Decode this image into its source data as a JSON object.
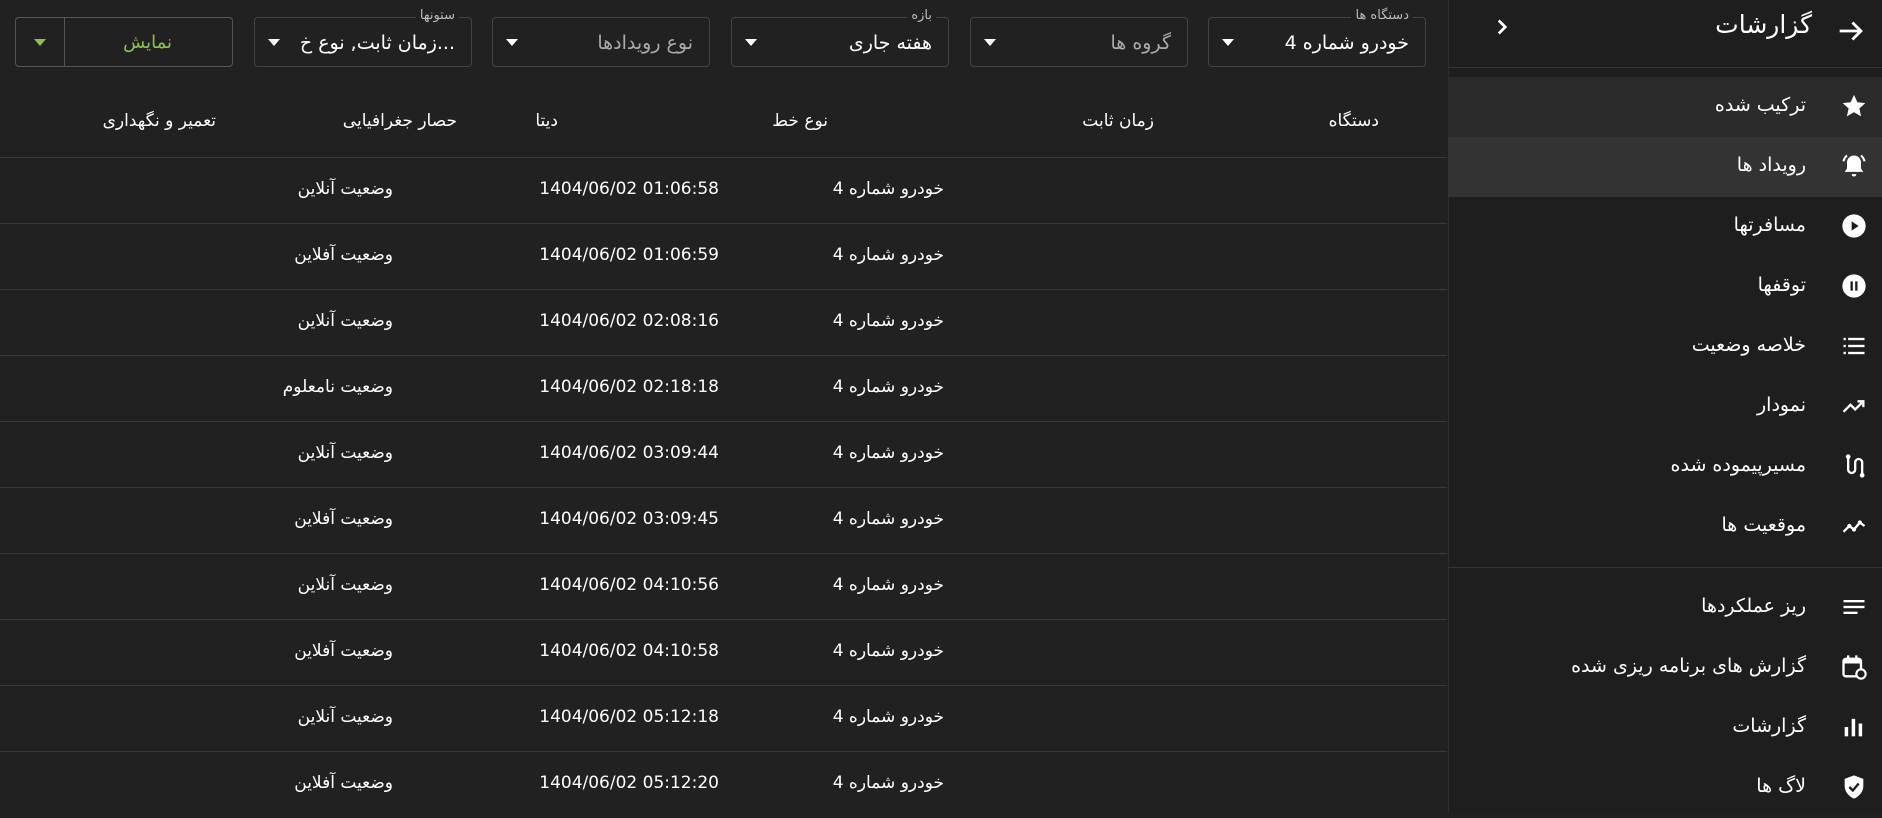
{
  "sidebar": {
    "title": "گزارشات",
    "items": [
      {
        "label": "ترکیب شده",
        "icon": "star-icon"
      },
      {
        "label": "رویداد ها",
        "icon": "bell-icon"
      },
      {
        "label": "مسافرتها",
        "icon": "play-circle-icon"
      },
      {
        "label": "توقفها",
        "icon": "pause-circle-icon"
      },
      {
        "label": "خلاصه وضعیت",
        "icon": "list-icon"
      },
      {
        "label": "نمودار",
        "icon": "trending-up-icon"
      },
      {
        "label": "مسیرپیموده شده",
        "icon": "route-icon"
      },
      {
        "label": "موقعیت ها",
        "icon": "timeline-icon"
      },
      {
        "label": "ریز عملکردها",
        "icon": "notes-icon"
      },
      {
        "label": "گزارش های برنامه ریزی شده",
        "icon": "calendar-clock-icon"
      },
      {
        "label": "گزارشات",
        "icon": "bar-chart-icon"
      },
      {
        "label": "لاگ ها",
        "icon": "shield-check-icon"
      }
    ]
  },
  "filters": {
    "devices": {
      "legend": "دستگاه ها",
      "value": "خودرو شماره 4"
    },
    "groups": {
      "placeholder": "گروه ها"
    },
    "period": {
      "legend": "بازه",
      "value": "هفته جاری"
    },
    "event_types": {
      "placeholder": "نوع رویدادها"
    },
    "columns": {
      "legend": "ستونها",
      "value": "زمان ثابت, نوع خ..."
    },
    "show_button": "نمایش"
  },
  "table": {
    "headers": {
      "device": "دستگاه",
      "fix_time": "زمان ثابت",
      "type": "نوع خط",
      "data": "دیتا",
      "geofence": "حصار جغرافیایی",
      "maintenance": "تعمیر و نگهداری"
    },
    "rows": [
      {
        "device": "خودرو شماره 4",
        "time": "1404/06/02 01:06:58",
        "type": "وضعیت آنلاین"
      },
      {
        "device": "خودرو شماره 4",
        "time": "1404/06/02 01:06:59",
        "type": "وضعیت آفلاین"
      },
      {
        "device": "خودرو شماره 4",
        "time": "1404/06/02 02:08:16",
        "type": "وضعیت آنلاین"
      },
      {
        "device": "خودرو شماره 4",
        "time": "1404/06/02 02:18:18",
        "type": "وضعیت نامعلوم"
      },
      {
        "device": "خودرو شماره 4",
        "time": "1404/06/02 03:09:44",
        "type": "وضعیت آنلاین"
      },
      {
        "device": "خودرو شماره 4",
        "time": "1404/06/02 03:09:45",
        "type": "وضعیت آفلاین"
      },
      {
        "device": "خودرو شماره 4",
        "time": "1404/06/02 04:10:56",
        "type": "وضعیت آنلاین"
      },
      {
        "device": "خودرو شماره 4",
        "time": "1404/06/02 04:10:58",
        "type": "وضعیت آفلاین"
      },
      {
        "device": "خودرو شماره 4",
        "time": "1404/06/02 05:12:18",
        "type": "وضعیت آنلاین"
      },
      {
        "device": "خودرو شماره 4",
        "time": "1404/06/02 05:12:20",
        "type": "وضعیت آفلاین"
      }
    ]
  },
  "colors": {
    "background": "#212121",
    "sidebar": "#1e1e1e",
    "accent": "#8bc34a"
  }
}
